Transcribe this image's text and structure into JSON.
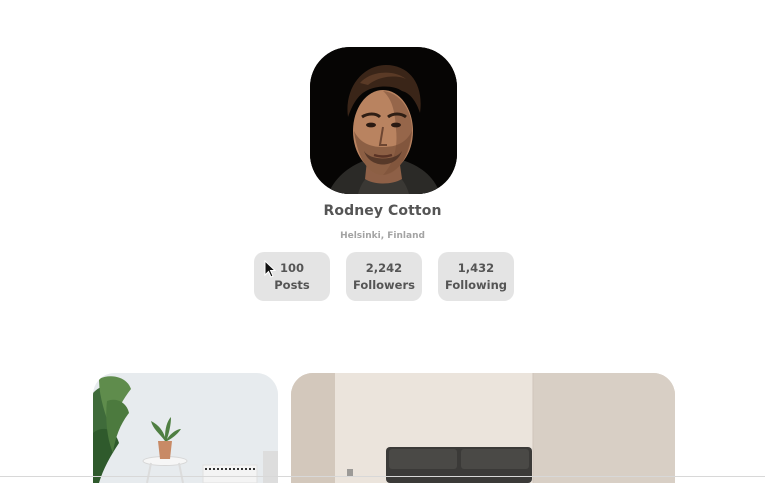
{
  "profile": {
    "name": "Rodney Cotton",
    "location": "Helsinki, Finland"
  },
  "stats": [
    {
      "value": "100",
      "label": "Posts"
    },
    {
      "value": "2,242",
      "label": "Followers"
    },
    {
      "value": "1,432",
      "label": "Following"
    }
  ],
  "colors": {
    "name_text": "#555555",
    "location_text": "#a3a3a3",
    "stat_background": "#e4e4e4"
  },
  "icons": {
    "cursor": "mouse-pointer-icon"
  }
}
